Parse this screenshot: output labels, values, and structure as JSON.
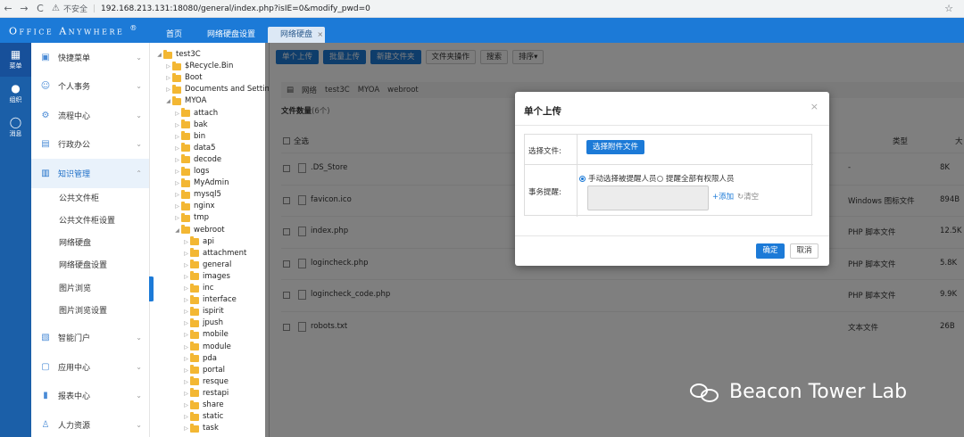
{
  "browser": {
    "back": "←",
    "forward": "→",
    "reload": "C",
    "security_label": "不安全",
    "url": "192.168.213.131:18080/general/index.php?isIE=0&modify_pwd=0"
  },
  "app": {
    "brand": "Office Anywhere",
    "brand_mark": "®",
    "tabs": [
      {
        "label": "首页"
      },
      {
        "label": "网络硬盘设置"
      },
      {
        "label": "网络硬盘",
        "active": true
      }
    ]
  },
  "rail": [
    {
      "label": "菜单",
      "icon": "grid-icon"
    },
    {
      "label": "组织",
      "icon": "people-icon"
    },
    {
      "label": "消息",
      "icon": "chat-icon"
    }
  ],
  "menu": {
    "items": [
      {
        "label": "快捷菜单",
        "icon": "shortcut-icon"
      },
      {
        "label": "个人事务",
        "icon": "person-icon"
      },
      {
        "label": "流程中心",
        "icon": "flow-icon"
      },
      {
        "label": "行政办公",
        "icon": "office-icon"
      },
      {
        "label": "知识管理",
        "icon": "knowledge-icon",
        "active": true
      },
      {
        "label": "智能门户",
        "icon": "portal-icon"
      },
      {
        "label": "应用中心",
        "icon": "app-icon"
      },
      {
        "label": "报表中心",
        "icon": "chart-icon"
      },
      {
        "label": "人力资源",
        "icon": "hr-icon"
      }
    ],
    "sub_items": [
      "公共文件柜",
      "公共文件柜设置",
      "网络硬盘",
      "网络硬盘设置",
      "图片浏览",
      "图片浏览设置"
    ]
  },
  "tree": {
    "nodes": [
      {
        "label": "test3C",
        "level": 0,
        "open": true
      },
      {
        "label": "$Recycle.Bin",
        "level": 1
      },
      {
        "label": "Boot",
        "level": 1
      },
      {
        "label": "Documents and Settings",
        "level": 1
      },
      {
        "label": "MYOA",
        "level": 1,
        "open": true
      },
      {
        "label": "attach",
        "level": 2
      },
      {
        "label": "bak",
        "level": 2
      },
      {
        "label": "bin",
        "level": 2
      },
      {
        "label": "data5",
        "level": 2
      },
      {
        "label": "decode",
        "level": 2
      },
      {
        "label": "logs",
        "level": 2
      },
      {
        "label": "MyAdmin",
        "level": 2
      },
      {
        "label": "mysql5",
        "level": 2
      },
      {
        "label": "nginx",
        "level": 2
      },
      {
        "label": "tmp",
        "level": 2
      },
      {
        "label": "webroot",
        "level": 2,
        "open": true
      },
      {
        "label": "api",
        "level": 3
      },
      {
        "label": "attachment",
        "level": 3
      },
      {
        "label": "general",
        "level": 3
      },
      {
        "label": "images",
        "level": 3
      },
      {
        "label": "inc",
        "level": 3
      },
      {
        "label": "interface",
        "level": 3
      },
      {
        "label": "ispirit",
        "level": 3
      },
      {
        "label": "jpush",
        "level": 3
      },
      {
        "label": "mobile",
        "level": 3
      },
      {
        "label": "module",
        "level": 3
      },
      {
        "label": "pda",
        "level": 3
      },
      {
        "label": "portal",
        "level": 3
      },
      {
        "label": "resque",
        "level": 3
      },
      {
        "label": "restapi",
        "level": 3
      },
      {
        "label": "share",
        "level": 3
      },
      {
        "label": "static",
        "level": 3
      },
      {
        "label": "task",
        "level": 3
      }
    ]
  },
  "main": {
    "toolbar": [
      {
        "label": "单个上传",
        "primary": true
      },
      {
        "label": "批量上传",
        "primary": true
      },
      {
        "label": "新建文件夹",
        "primary": true
      },
      {
        "label": "文件夹操作"
      },
      {
        "label": "搜索"
      },
      {
        "label": "排序▾"
      }
    ],
    "breadcrumb": [
      "网络",
      "test3C",
      "MYOA",
      "webroot"
    ],
    "count_label": "文件数量",
    "count_value": "(6个)",
    "select_all": "全选",
    "col_type": "类型",
    "col_size": "大",
    "files": [
      {
        "name": ".DS_Store",
        "type": "-",
        "size": "8K"
      },
      {
        "name": "favicon.ico",
        "type": "Windows 图标文件",
        "size": "894B"
      },
      {
        "name": "index.php",
        "type": "PHP 脚本文件",
        "size": "12.5K"
      },
      {
        "name": "logincheck.php",
        "type": "PHP 脚本文件",
        "size": "5.8K"
      },
      {
        "name": "logincheck_code.php",
        "type": "PHP 脚本文件",
        "size": "9.9K"
      },
      {
        "name": "robots.txt",
        "type": "文本文件",
        "size": "26B"
      }
    ]
  },
  "modal": {
    "title": "单个上传",
    "close": "×",
    "file_label": "选择文件:",
    "pick_button": "选择附件文件",
    "remind_label": "事务提醒:",
    "radio_manual": "手动选择被提醒人员",
    "radio_all": "提醒全部有权限人员",
    "add": "添加",
    "clear": "清空",
    "ok": "确定",
    "cancel": "取消"
  },
  "watermark": "Beacon Tower Lab"
}
